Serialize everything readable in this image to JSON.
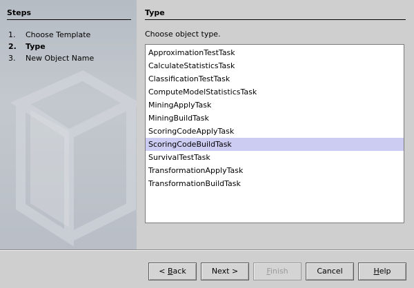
{
  "steps": {
    "title": "Steps",
    "items": [
      {
        "num": "1.",
        "label": "Choose Template"
      },
      {
        "num": "2.",
        "label": "Type"
      },
      {
        "num": "3.",
        "label": "New Object Name"
      }
    ]
  },
  "content": {
    "title": "Type",
    "prompt": "Choose object type.",
    "types": [
      "ApproximationTestTask",
      "CalculateStatisticsTask",
      "ClassificationTestTask",
      "ComputeModelStatisticsTask",
      "MiningApplyTask",
      "MiningBuildTask",
      "ScoringCodeApplyTask",
      "ScoringCodeBuildTask",
      "SurvivalTestTask",
      "TransformationApplyTask",
      "TransformationBuildTask"
    ],
    "selected_type": "ScoringCodeBuildTask"
  },
  "buttons": {
    "back": {
      "prefix": "< ",
      "mnemonic": "B",
      "rest": "ack"
    },
    "next": "Next >",
    "finish": {
      "mnemonic": "F",
      "rest": "inish"
    },
    "cancel": "Cancel",
    "help": {
      "mnemonic": "H",
      "rest": "elp"
    }
  },
  "colors": {
    "selection": "#ccccf2",
    "panel": "#cfcfcf"
  }
}
